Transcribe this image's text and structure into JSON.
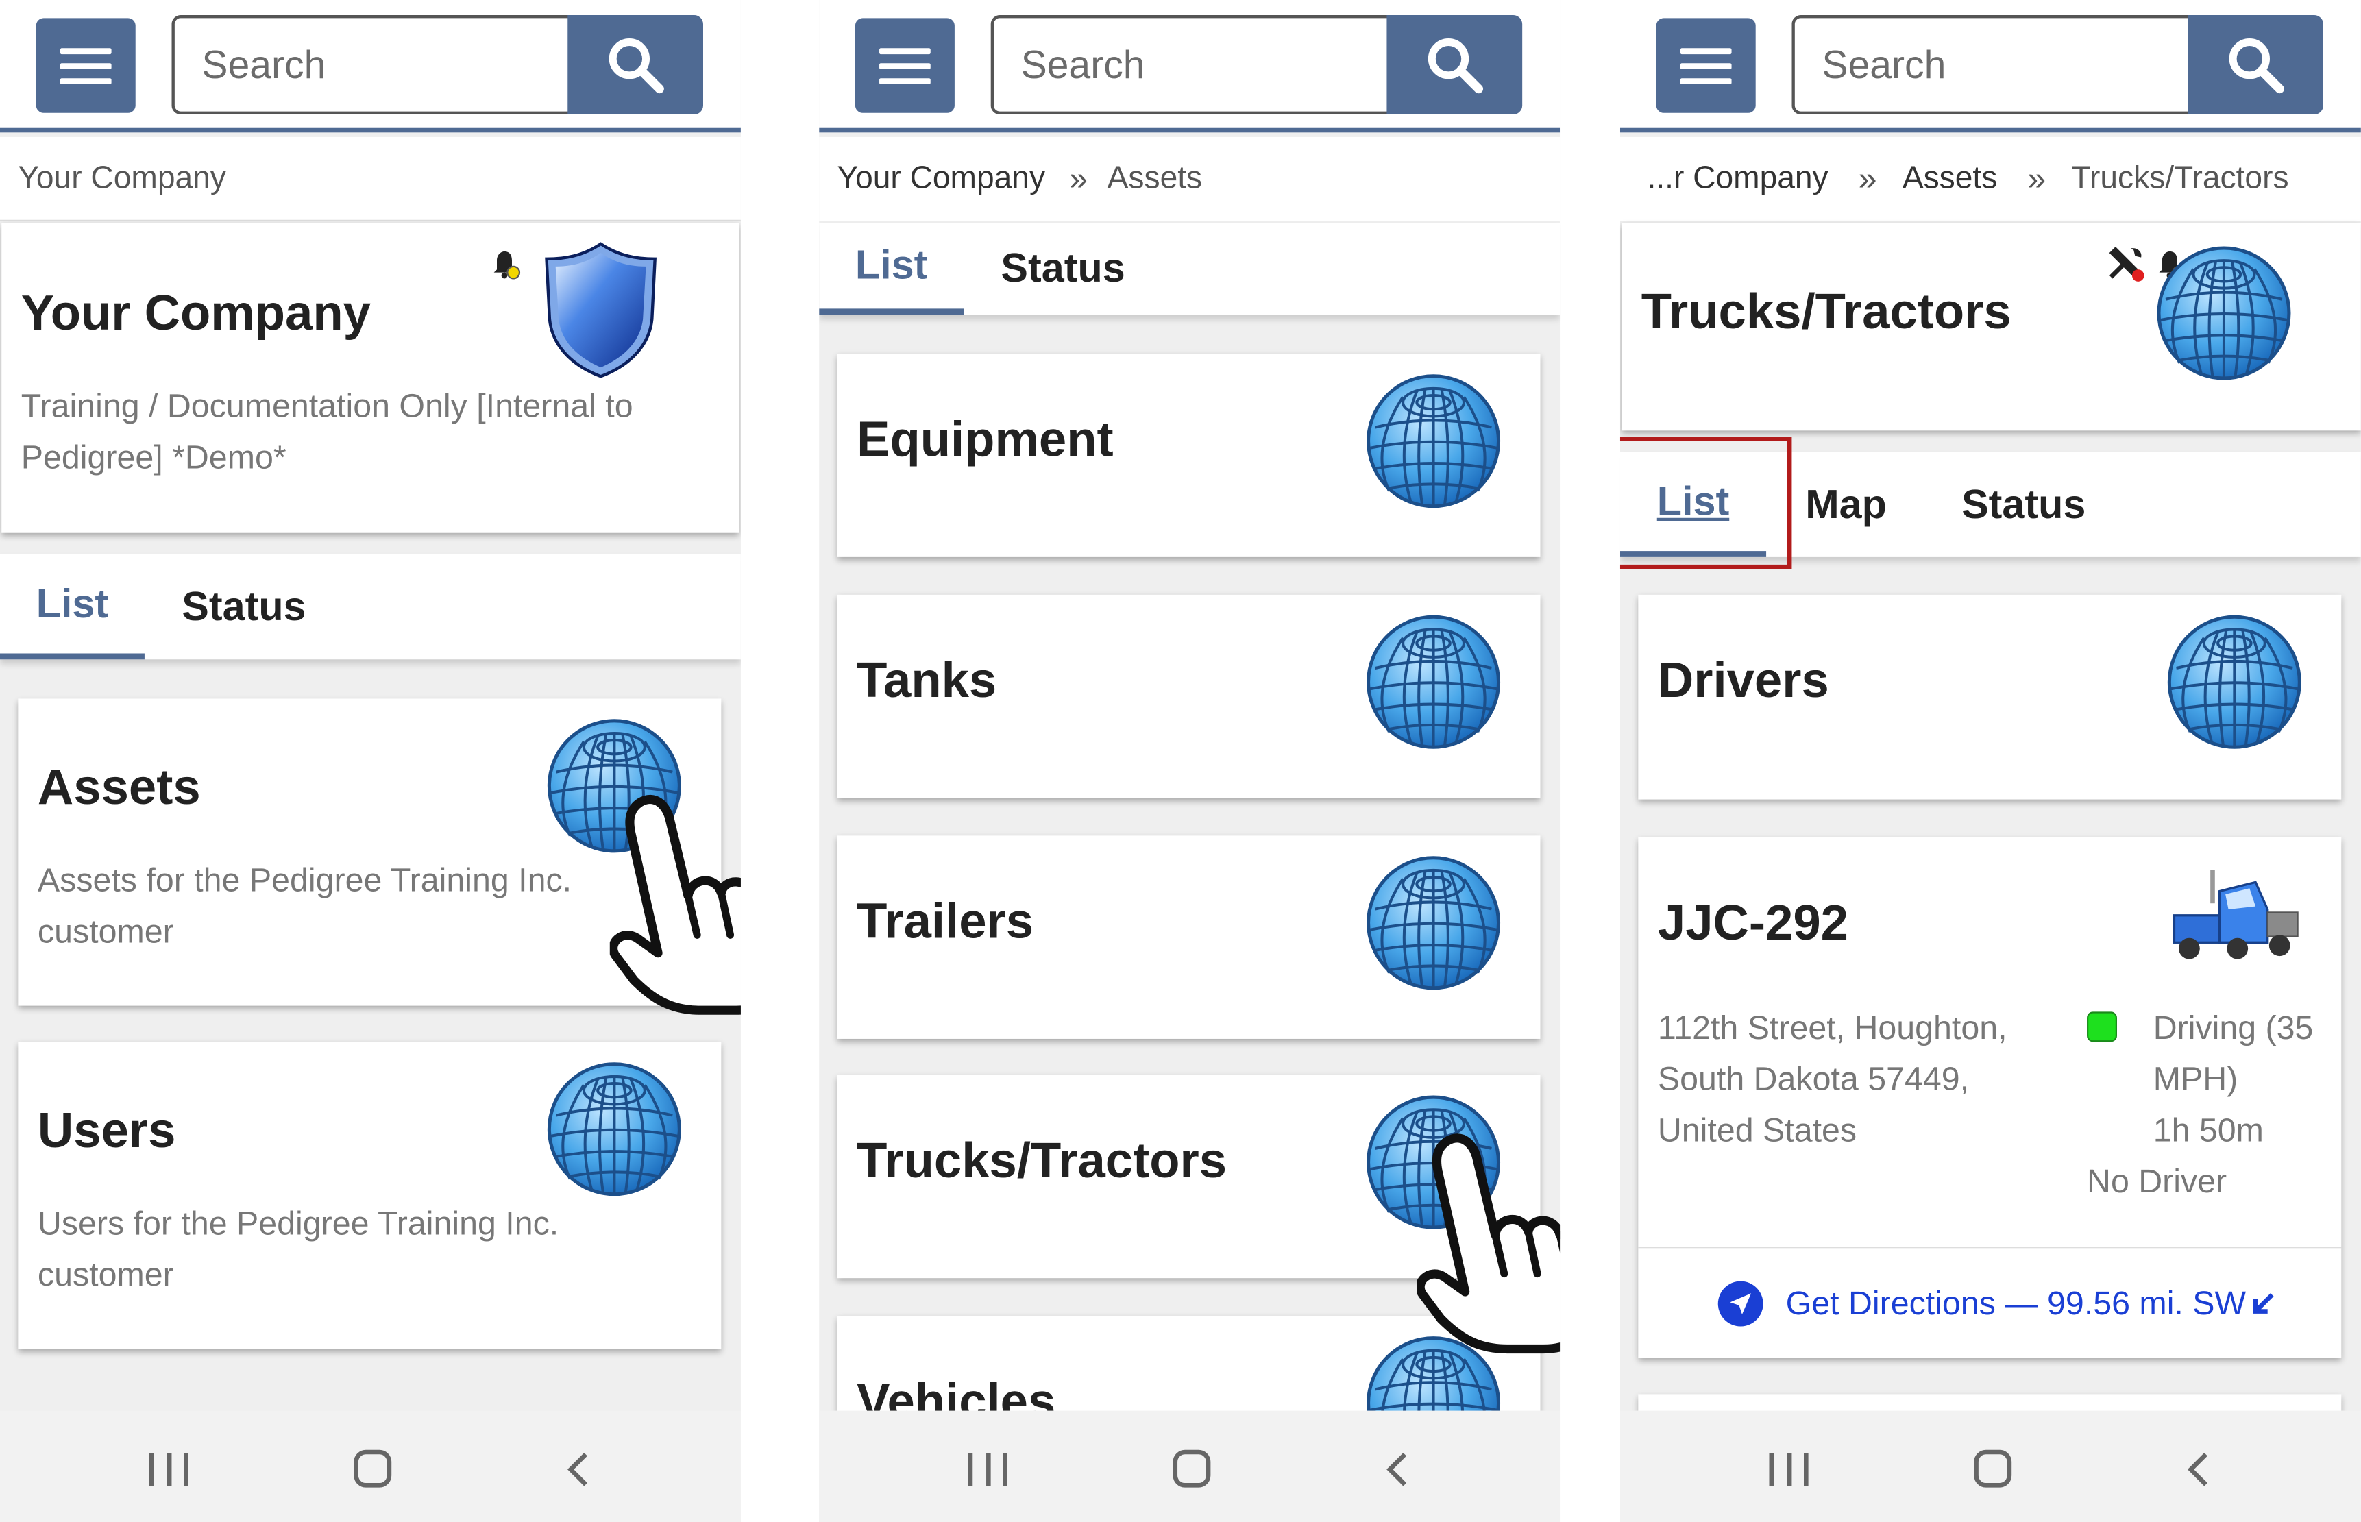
{
  "search": {
    "placeholder": "Search"
  },
  "panel1": {
    "breadcrumb": [
      "Your Company"
    ],
    "company_card": {
      "title": "Your Company",
      "description": "Training / Documentation Only [Internal to Pedigree] *Demo*"
    },
    "tabs": [
      "List",
      "Status"
    ],
    "items": [
      {
        "title": "Assets",
        "description": "Assets for the Pedigree Training Inc. customer"
      },
      {
        "title": "Users",
        "description": "Users for the Pedigree Training Inc. customer"
      }
    ]
  },
  "panel2": {
    "breadcrumb": [
      "Your Company",
      "Assets"
    ],
    "tabs": [
      "List",
      "Status"
    ],
    "items": [
      {
        "title": "Equipment"
      },
      {
        "title": "Tanks"
      },
      {
        "title": "Trailers"
      },
      {
        "title": "Trucks/Tractors"
      },
      {
        "title": "Vehicles"
      }
    ]
  },
  "panel3": {
    "breadcrumb": [
      "...r Company",
      "Assets",
      "Trucks/Tractors"
    ],
    "header_card": {
      "title": "Trucks/Tractors"
    },
    "tabs": [
      "List",
      "Map",
      "Status"
    ],
    "items": [
      {
        "title": "Drivers"
      },
      {
        "title": "JJC-292",
        "address": "112th Street, Houghton, South Dakota 57449, United States",
        "status": "Driving (35 MPH)",
        "duration": "1h 50m",
        "driver": "No Driver",
        "status_color": "#1ee01e",
        "directions": "Get Directions — 99.56 mi. SW"
      }
    ]
  },
  "breadcrumb_separator": "»",
  "colors": {
    "primary": "#4f6a93",
    "link": "#1a3fd4",
    "highlight": "#b21b1b"
  },
  "icons": {
    "menu": "hamburger-icon",
    "search": "search-icon",
    "globe": "globe-icon",
    "shield": "shield-icon",
    "bell": "bell-icon",
    "tools": "tools-icon",
    "truck": "truck-icon",
    "hand": "pointing-hand-icon",
    "navigate": "navigation-arrow-icon"
  }
}
